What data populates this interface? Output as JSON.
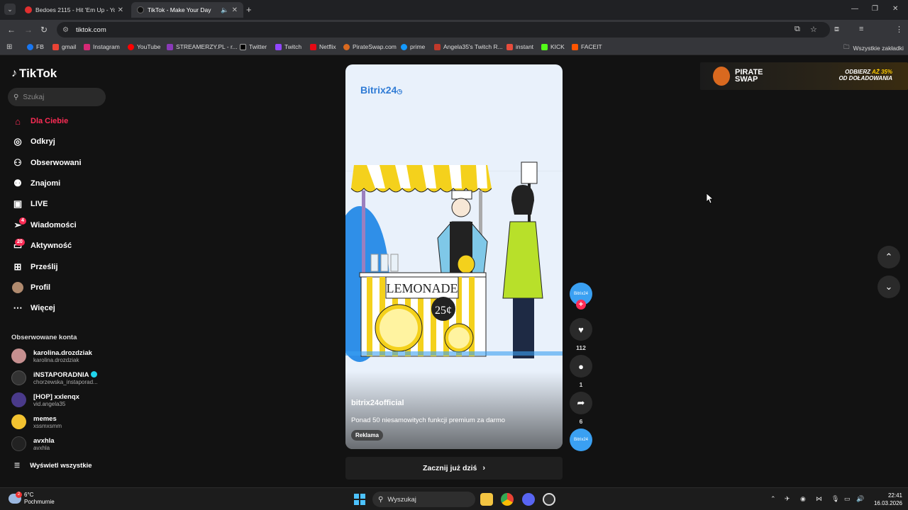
{
  "browser": {
    "tabs": [
      {
        "title": "Bedoes 2115 - Hit 'Em Up - You",
        "active": false
      },
      {
        "title": "TikTok - Make Your Day",
        "active": true
      }
    ],
    "url": "tiktok.com",
    "bookmarks": [
      "FB",
      "gmail",
      "Instagram",
      "YouTube",
      "STREAMERZY.PL - r...",
      "Twitter",
      "Twitch",
      "Netflix",
      "PirateSwap.com",
      "prime",
      "Angela35's Twitch R...",
      "instant",
      "KICK",
      "FACEIT"
    ],
    "all_bookmarks": "Wszystkie zakładki"
  },
  "sidebar": {
    "logo": "TikTok",
    "search_placeholder": "Szukaj",
    "nav": [
      {
        "label": "Dla Ciebie",
        "icon": "home-icon",
        "active": true
      },
      {
        "label": "Odkryj",
        "icon": "compass-icon"
      },
      {
        "label": "Obserwowani",
        "icon": "following-icon"
      },
      {
        "label": "Znajomi",
        "icon": "friends-icon"
      },
      {
        "label": "LIVE",
        "icon": "live-icon"
      },
      {
        "label": "Wiadomości",
        "icon": "messages-icon",
        "badge": "4"
      },
      {
        "label": "Aktywność",
        "icon": "activity-icon",
        "badge": "20"
      },
      {
        "label": "Prześlij",
        "icon": "upload-icon"
      },
      {
        "label": "Profil",
        "icon": "profile-icon"
      },
      {
        "label": "Więcej",
        "icon": "more-icon"
      }
    ],
    "followed_title": "Obserwowane konta",
    "accounts": [
      {
        "name": "karolina.drozdziak",
        "handle": "karolina.drozdziak"
      },
      {
        "name": "iNSTAPORADNIA",
        "handle": "chorzewska_instaporad...",
        "verified": true
      },
      {
        "name": "[HOP] xxlenqx",
        "handle": "vid.angela35"
      },
      {
        "name": "memes",
        "handle": "xssmxsmm"
      },
      {
        "name": "avxhla",
        "handle": "avxhla"
      }
    ],
    "show_all": "Wyświetl wszystkie"
  },
  "video": {
    "brand": "Bitrix24",
    "sign_text": "LEMONADE",
    "price_text": "25¢",
    "author": "bitrix24official",
    "description": "Ponad 50 niesamowitych funkcji premium za darmo",
    "ad_label": "Reklama",
    "cta": "Zacznij już dziś"
  },
  "actions": {
    "avatar_text": "Bitrix24",
    "likes": "112",
    "comments": "1",
    "shares": "6"
  },
  "ad_banner": {
    "brand_line1": "PIRATE",
    "brand_line2": "SWAP",
    "promo_line1_a": "ODBIERZ",
    "promo_line1_b": "AŻ 35%",
    "promo_line2": "OD DOŁADOWANIA"
  },
  "taskbar": {
    "temp": "6°C",
    "weather": "Pochmurnie",
    "weather_badge": "2",
    "search": "Wyszukaj",
    "time": "22:41",
    "date": "16.03.2026"
  },
  "colors": {
    "accent": "#fe2c55",
    "verified": "#20d5ec",
    "bitrix": "#2f7bd5"
  }
}
